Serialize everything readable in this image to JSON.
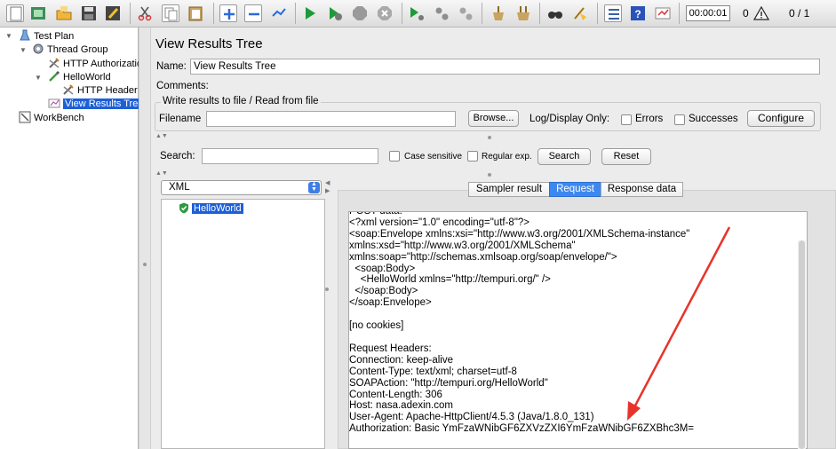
{
  "toolbar": {
    "icons": [
      "new-icon",
      "templates-icon",
      "open-icon",
      "save-icon",
      "save-as-icon",
      "cut-icon",
      "copy-icon",
      "paste-icon",
      "expand-icon",
      "collapse-icon",
      "toggle-icon",
      "start-icon",
      "start-no-pauses-icon",
      "stop-icon",
      "shutdown-icon",
      "remote-start-icon",
      "remote-stop-icon",
      "remote-shutdown-icon",
      "clear-icon",
      "clear-all-icon",
      "search-icon",
      "reset-search-icon",
      "function-helper-icon",
      "help-icon",
      "log-viewer-icon"
    ],
    "timer": "00:00:01",
    "error_count": "0",
    "threads": "0 / 1"
  },
  "tree": {
    "test_plan": "Test Plan",
    "thread_group": "Thread Group",
    "http_authorization": "HTTP Authorizatio",
    "hello_world": "HelloWorld",
    "http_header": "HTTP Header",
    "view_results_tree": "View Results Tree",
    "workbench": "WorkBench"
  },
  "panel": {
    "title": "View Results Tree",
    "name_label": "Name:",
    "name_value": "View Results Tree",
    "comments_label": "Comments:",
    "file_group_title": "Write results to file / Read from file",
    "filename_label": "Filename",
    "filename_value": "",
    "browse_label": "Browse...",
    "log_display_label": "Log/Display Only:",
    "errors_label": "Errors",
    "successes_label": "Successes",
    "configure_label": "Configure",
    "search_label": "Search:",
    "search_value": "",
    "case_sensitive_label": "Case sensitive",
    "regular_exp_label": "Regular exp.",
    "search_button": "Search",
    "reset_button": "Reset",
    "renderer_selected": "XML",
    "result_item": "HelloWorld"
  },
  "tabs": {
    "sampler_result": "Sampler result",
    "request": "Request",
    "response_data": "Response data"
  },
  "request_lines": [
    "POST data:",
    "<?xml version=\"1.0\" encoding=\"utf-8\"?>",
    "<soap:Envelope xmlns:xsi=\"http://www.w3.org/2001/XMLSchema-instance\"",
    "xmlns:xsd=\"http://www.w3.org/2001/XMLSchema\"",
    "xmlns:soap=\"http://schemas.xmlsoap.org/soap/envelope/\">",
    "  <soap:Body>",
    "    <HelloWorld xmlns=\"http://tempuri.org/\" />",
    "  </soap:Body>",
    "</soap:Envelope>",
    "",
    "[no cookies]",
    "",
    "Request Headers:",
    "Connection: keep-alive",
    "Content-Type: text/xml; charset=utf-8",
    "SOAPAction: \"http://tempuri.org/HelloWorld\"",
    "Content-Length: 306",
    "Host: nasa.adexin.com",
    "User-Agent: Apache-HttpClient/4.5.3 (Java/1.8.0_131)",
    "Authorization: Basic YmFzaWNibGF6ZXVzZXI6YmFzaWNibGF6ZXBhc3M="
  ],
  "colors": {
    "selection": "#1d5fd6",
    "active_tab": "#3d88f0",
    "annotation_arrow": "#e8332a"
  }
}
